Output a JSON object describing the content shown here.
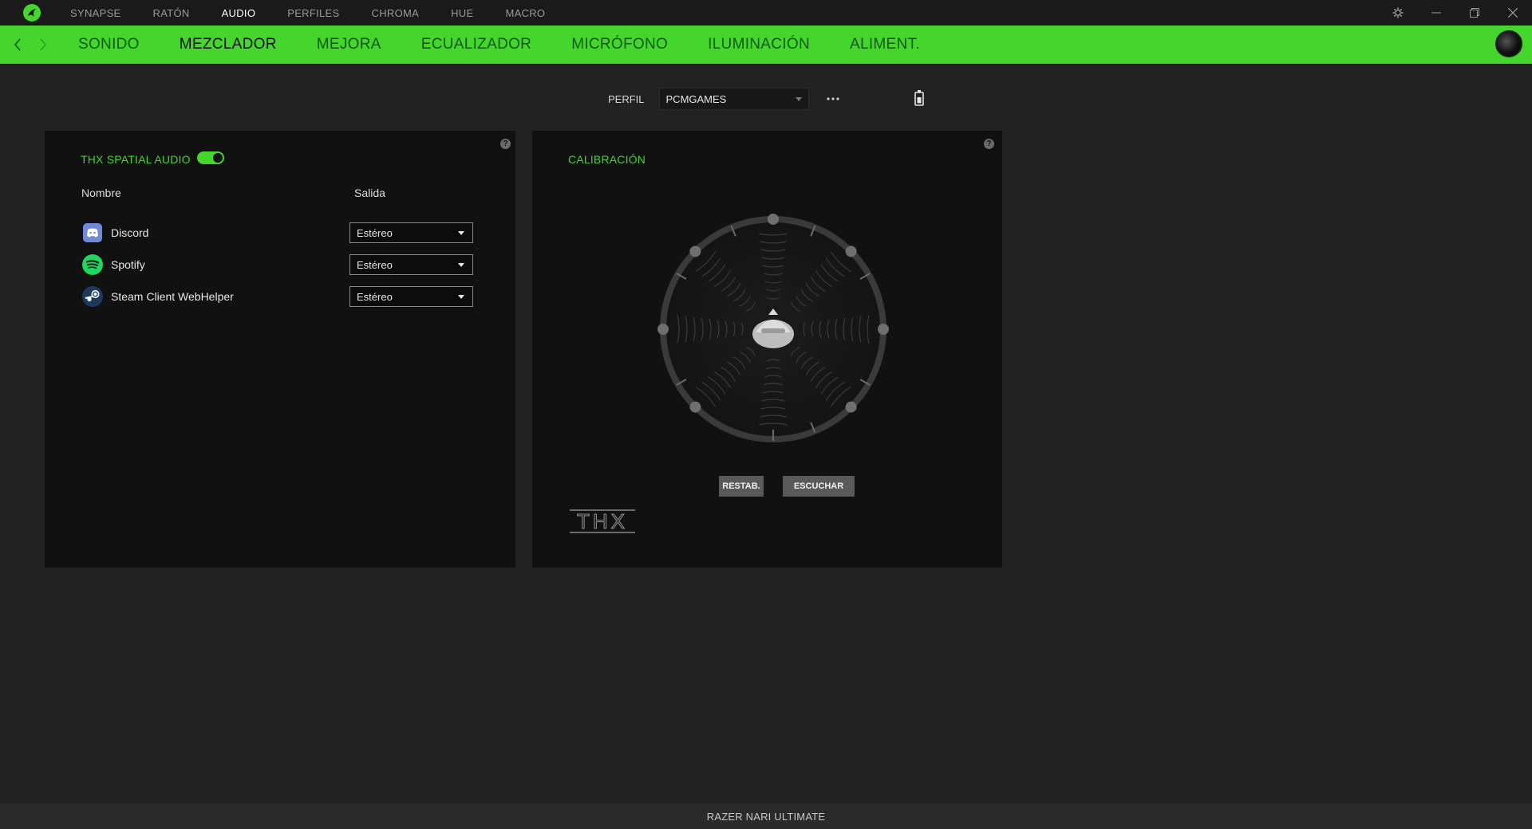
{
  "titlebar": {
    "nav": [
      {
        "label": "SYNAPSE",
        "active": false
      },
      {
        "label": "RATÓN",
        "active": false
      },
      {
        "label": "AUDIO",
        "active": true
      },
      {
        "label": "PERFILES",
        "active": false
      },
      {
        "label": "CHROMA",
        "active": false
      },
      {
        "label": "HUE",
        "active": false
      },
      {
        "label": "MACRO",
        "active": false
      }
    ]
  },
  "subnav": {
    "tabs": [
      {
        "label": "SONIDO"
      },
      {
        "label": "MEZCLADOR"
      },
      {
        "label": "MEJORA"
      },
      {
        "label": "ECUALIZADOR"
      },
      {
        "label": "MICRÓFONO"
      },
      {
        "label": "ILUMINACIÓN"
      },
      {
        "label": "ALIMENT."
      }
    ]
  },
  "profile": {
    "label": "PERFIL",
    "selected": "PCMGAMES"
  },
  "mixer": {
    "title": "THX SPATIAL AUDIO",
    "enabled": true,
    "col_name": "Nombre",
    "col_output": "Salida",
    "apps": [
      {
        "name": "Discord",
        "output": "Estéreo",
        "icon": "discord-icon"
      },
      {
        "name": "Spotify",
        "output": "Estéreo",
        "icon": "spotify-icon"
      },
      {
        "name": "Steam Client WebHelper",
        "output": "Estéreo",
        "icon": "steam-icon"
      }
    ]
  },
  "calibration": {
    "title": "CALIBRACIÓN",
    "reset_label": "RESTAB.",
    "listen_label": "ESCUCHAR",
    "logo_text": "THX"
  },
  "statusbar": {
    "device": "RAZER NARI ULTIMATE"
  },
  "colors": {
    "accent": "#44d62c",
    "background": "#222222",
    "panel": "#111111"
  }
}
